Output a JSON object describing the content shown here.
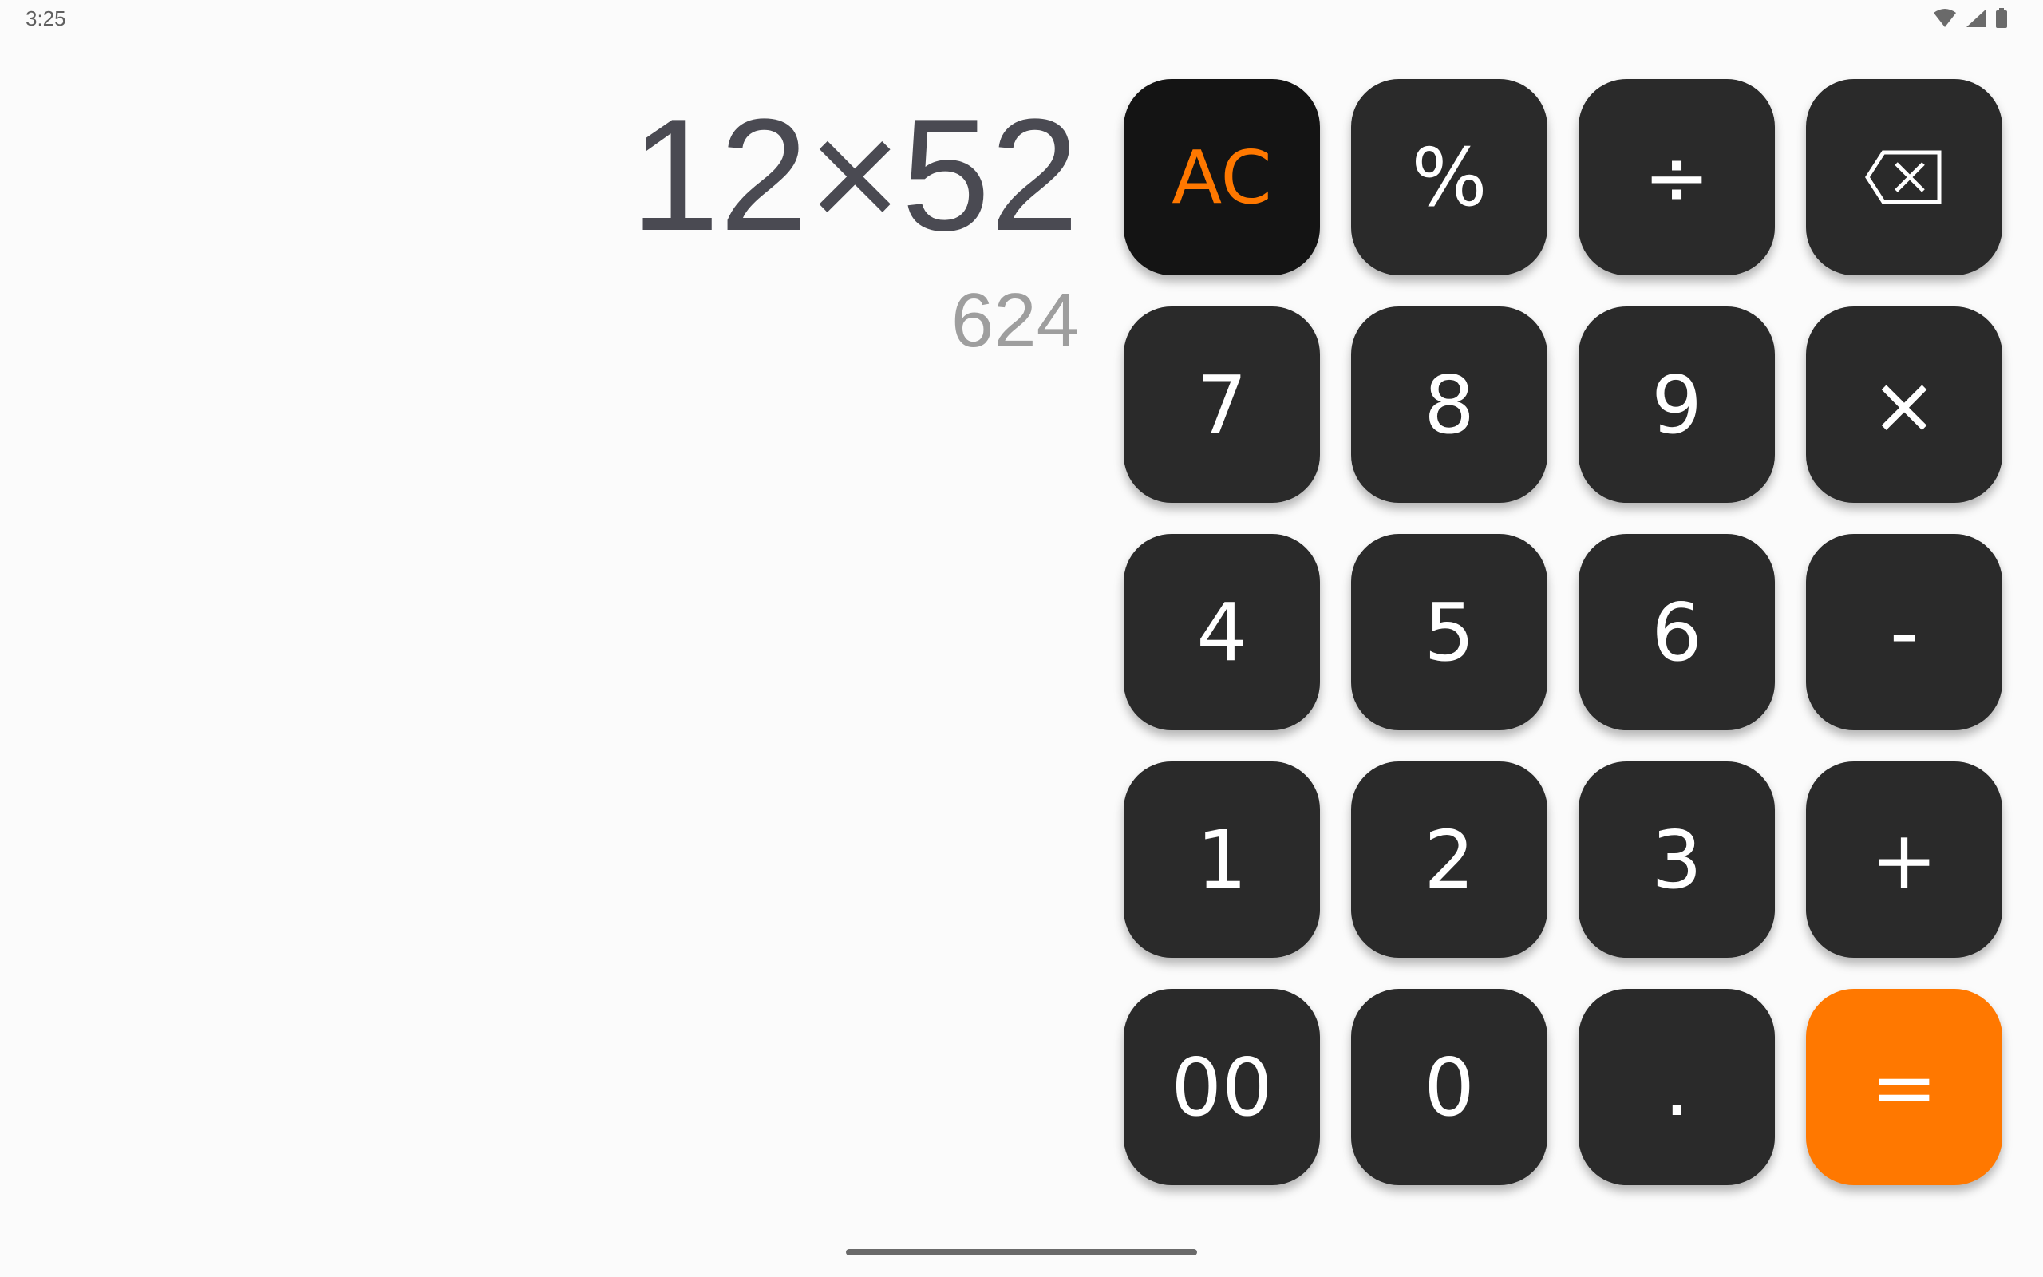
{
  "status_bar": {
    "time": "3:25",
    "icons": [
      "wifi-icon",
      "cellular-signal-icon",
      "battery-icon"
    ]
  },
  "display": {
    "expression": "12×52",
    "result": "624"
  },
  "keypad": {
    "rows": [
      [
        {
          "label": "AC",
          "name": "clear-button",
          "style": "ac"
        },
        {
          "label": "%",
          "name": "percent-button"
        },
        {
          "label": "÷",
          "name": "divide-button"
        },
        {
          "label": "",
          "name": "backspace-button",
          "icon": "backspace-icon"
        }
      ],
      [
        {
          "label": "7",
          "name": "digit-7-button"
        },
        {
          "label": "8",
          "name": "digit-8-button"
        },
        {
          "label": "9",
          "name": "digit-9-button"
        },
        {
          "label": "×",
          "name": "multiply-button"
        }
      ],
      [
        {
          "label": "4",
          "name": "digit-4-button"
        },
        {
          "label": "5",
          "name": "digit-5-button"
        },
        {
          "label": "6",
          "name": "digit-6-button"
        },
        {
          "label": "-",
          "name": "subtract-button"
        }
      ],
      [
        {
          "label": "1",
          "name": "digit-1-button"
        },
        {
          "label": "2",
          "name": "digit-2-button"
        },
        {
          "label": "3",
          "name": "digit-3-button"
        },
        {
          "label": "+",
          "name": "add-button"
        }
      ],
      [
        {
          "label": "00",
          "name": "double-zero-button"
        },
        {
          "label": "0",
          "name": "digit-0-button"
        },
        {
          "label": ".",
          "name": "decimal-point-button"
        },
        {
          "label": "=",
          "name": "equals-button",
          "style": "equals"
        }
      ]
    ]
  },
  "colors": {
    "accent": "#ff7800",
    "key_background": "#2a2a2a",
    "clear_key_background": "#141414",
    "expression_text": "#4a4a52",
    "result_text": "#9e9e9e",
    "page_background": "#fbfbfb"
  }
}
